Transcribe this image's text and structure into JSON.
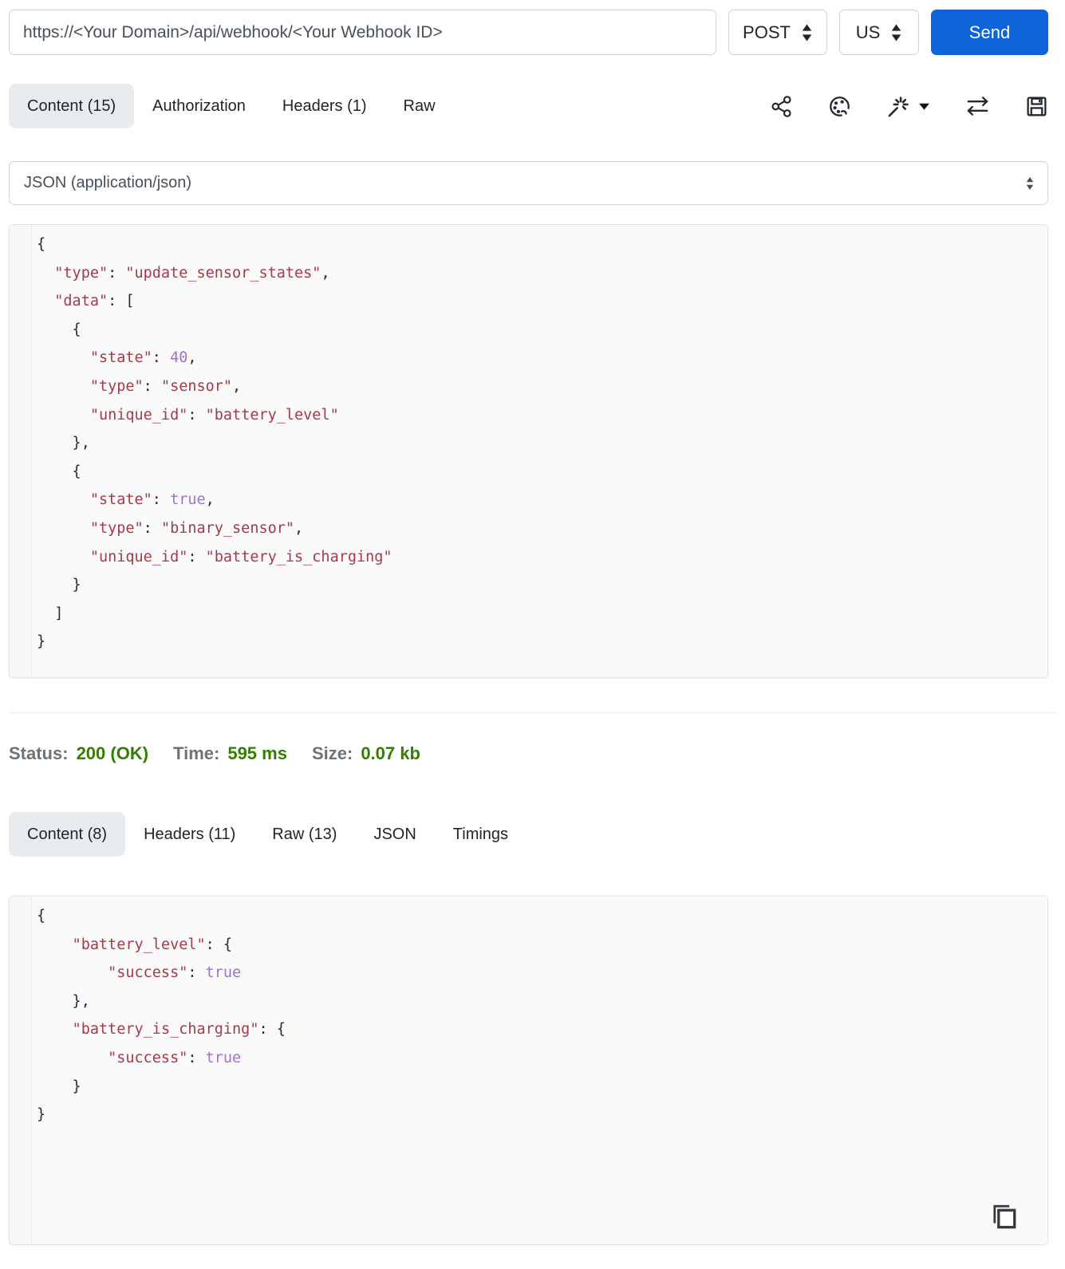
{
  "request": {
    "url": "https://<Your Domain>/api/webhook/<Your Webhook ID>",
    "method": "POST",
    "region": "US",
    "send_label": "Send",
    "tabs": [
      "Content (15)",
      "Authorization",
      "Headers (1)",
      "Raw"
    ],
    "content_type": "JSON (application/json)",
    "body": "{\n  \"type\": \"update_sensor_states\",\n  \"data\": [\n    {\n      \"state\": 40,\n      \"type\": \"sensor\",\n      \"unique_id\": \"battery_level\"\n    },\n    {\n      \"state\": true,\n      \"type\": \"binary_sensor\",\n      \"unique_id\": \"battery_is_charging\"\n    }\n  ]\n}"
  },
  "response": {
    "status": {
      "label": "Status:",
      "value": "200 (OK)"
    },
    "time": {
      "label": "Time:",
      "value": "595 ms"
    },
    "size": {
      "label": "Size:",
      "value": "0.07 kb"
    },
    "tabs": [
      "Content (8)",
      "Headers (11)",
      "Raw (13)",
      "JSON",
      "Timings"
    ],
    "body": "{\n    \"battery_level\": {\n        \"success\": true\n    },\n    \"battery_is_charging\": {\n        \"success\": true\n    }\n}"
  },
  "toolbar": {
    "icons": [
      "share-icon",
      "palette-icon",
      "magic-wand-icon",
      "swap-arrows-icon",
      "save-icon"
    ]
  },
  "icons_misc": [
    "updown-caret-icon",
    "dropdown-caret-icon",
    "copy-icon"
  ],
  "colors": {
    "accent_blue": "#0d64d8",
    "status_green": "#338000",
    "code_string": "#a33b49",
    "code_atom": "#a173c5",
    "active_tab_bg": "#e9ecef"
  }
}
